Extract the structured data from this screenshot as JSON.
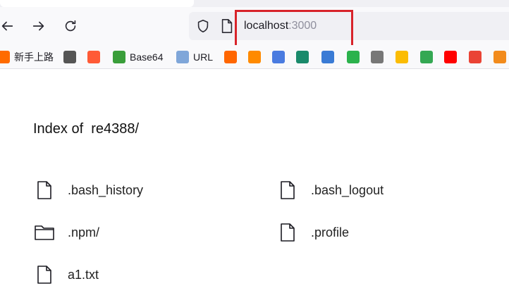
{
  "browser": {
    "url_host": "localhost",
    "url_port": ":3000",
    "highlight_color": "#d8232a"
  },
  "bookmarks": [
    {
      "icon": "app-icon",
      "label": "新手上路",
      "color": "#ff6b00"
    },
    {
      "icon": "globe-icon",
      "label": "",
      "color": "#555555"
    },
    {
      "icon": "bolt-icon",
      "label": "",
      "color": "#ff5a36"
    },
    {
      "icon": "base64-icon",
      "label": "Base64",
      "color": "#3a9e3a"
    },
    {
      "icon": "url-icon",
      "label": "URL",
      "color": "#7fa6d9"
    },
    {
      "icon": "y-icon",
      "label": "",
      "color": "#ff6600"
    },
    {
      "icon": "clock-icon",
      "label": "",
      "color": "#ff8a00"
    },
    {
      "icon": "translate-icon",
      "label": "",
      "color": "#4a7be0"
    },
    {
      "icon": "leaf-icon",
      "label": "",
      "color": "#1a8a6b"
    },
    {
      "icon": "puzzle-icon",
      "label": "",
      "color": "#3a7bd5"
    },
    {
      "icon": "feedly-icon",
      "label": "",
      "color": "#2bb24c"
    },
    {
      "icon": "mail-icon",
      "label": "",
      "color": "#777777"
    },
    {
      "icon": "photos-icon",
      "label": "",
      "color": "#fbbc04"
    },
    {
      "icon": "maps-icon",
      "label": "",
      "color": "#34a853"
    },
    {
      "icon": "youtube-icon",
      "label": "",
      "color": "#ff0000"
    },
    {
      "icon": "gmail-icon",
      "label": "",
      "color": "#ea4335"
    },
    {
      "icon": "box-icon",
      "label": "",
      "color": "#f28b1c"
    }
  ],
  "listing": {
    "title": "Index of  re4388/",
    "entries": [
      {
        "name": ".bash_history",
        "type": "file"
      },
      {
        "name": ".bash_logout",
        "type": "file"
      },
      {
        "name": ".npm/",
        "type": "folder"
      },
      {
        "name": ".profile",
        "type": "file"
      },
      {
        "name": "a1.txt",
        "type": "file"
      }
    ]
  }
}
